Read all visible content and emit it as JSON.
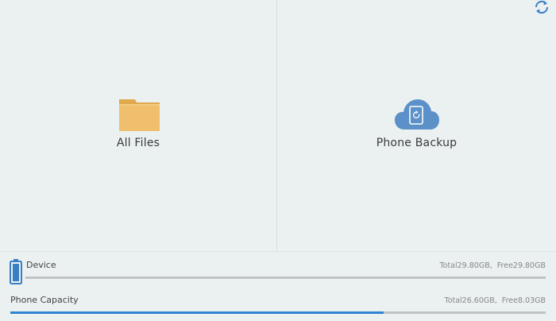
{
  "tiles": {
    "all_files": {
      "label": "All Files",
      "icon": "folder-icon",
      "color": "#f0bf6e"
    },
    "phone_backup": {
      "label": "Phone Backup",
      "icon": "cloud-phone-icon",
      "color": "#5b91c8"
    }
  },
  "toolbar": {
    "refresh_icon": "refresh-icon",
    "accent": "#3a7fc4"
  },
  "storage": {
    "device": {
      "label": "Device",
      "total": "Total29.80GB,",
      "free": "Free29.80GB",
      "used_fraction": 0.0
    },
    "phone": {
      "label": "Phone Capacity",
      "total": "Total26.60GB,",
      "free": "Free8.03GB",
      "used_fraction": 0.698
    },
    "bar_color": "#2f84d1"
  }
}
